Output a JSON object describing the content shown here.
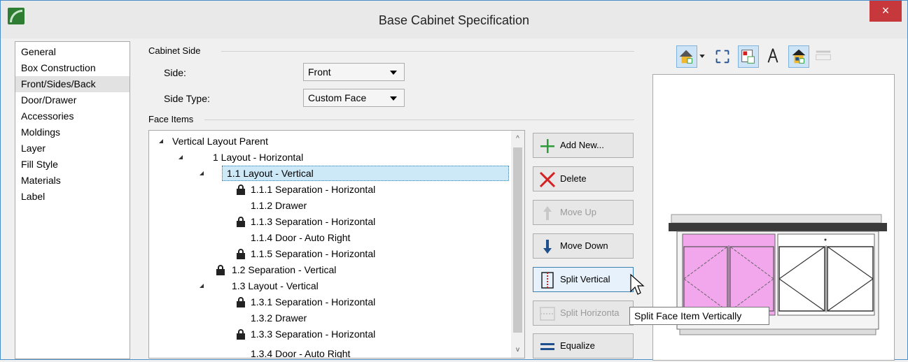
{
  "window": {
    "title": "Base Cabinet Specification",
    "close_glyph": "×"
  },
  "sidebar": {
    "items": [
      {
        "label": "General"
      },
      {
        "label": "Box Construction"
      },
      {
        "label": "Front/Sides/Back"
      },
      {
        "label": "Door/Drawer"
      },
      {
        "label": "Accessories"
      },
      {
        "label": "Moldings"
      },
      {
        "label": "Layer"
      },
      {
        "label": "Fill Style"
      },
      {
        "label": "Materials"
      },
      {
        "label": "Label"
      }
    ],
    "selected": "Front/Sides/Back"
  },
  "cabinet_side": {
    "section_title": "Cabinet Side",
    "side_label": "Side:",
    "side_value": "Front",
    "side_type_label": "Side Type:",
    "side_type_value": "Custom Face"
  },
  "face_items": {
    "section_title": "Face Items",
    "tree": [
      {
        "label": "Vertical Layout Parent"
      },
      {
        "label": "1 Layout - Horizontal"
      },
      {
        "label": "1.1 Layout - Vertical"
      },
      {
        "label": "1.1.1 Separation - Horizontal"
      },
      {
        "label": "1.1.2 Drawer"
      },
      {
        "label": "1.1.3 Separation - Horizontal"
      },
      {
        "label": "1.1.4 Door - Auto Right"
      },
      {
        "label": "1.1.5 Separation - Horizontal"
      },
      {
        "label": "1.2 Separation - Vertical"
      },
      {
        "label": "1.3 Layout - Vertical"
      },
      {
        "label": "1.3.1 Separation - Horizontal"
      },
      {
        "label": "1.3.2 Drawer"
      },
      {
        "label": "1.3.3 Separation - Horizontal"
      },
      {
        "label": "1.3.4 Door - Auto Right"
      }
    ],
    "scroll_up": "^",
    "scroll_down": "v"
  },
  "buttons": {
    "add_new": "Add New...",
    "delete": "Delete",
    "move_up": "Move Up",
    "move_down": "Move Down",
    "split_vertical": "Split Vertical",
    "split_horizontal": "Split Horizonta",
    "equalize": "Equalize"
  },
  "tooltip": {
    "text": "Split Face Item Vertically"
  },
  "colors": {
    "accent": "#3c7fb1",
    "close": "#c7383c",
    "selection": "#cde8f7",
    "door_highlight": "#f2a6ec",
    "add_green": "#2e9b3a",
    "delete_red": "#d32020",
    "arrow_blue": "#1f4f8c"
  }
}
